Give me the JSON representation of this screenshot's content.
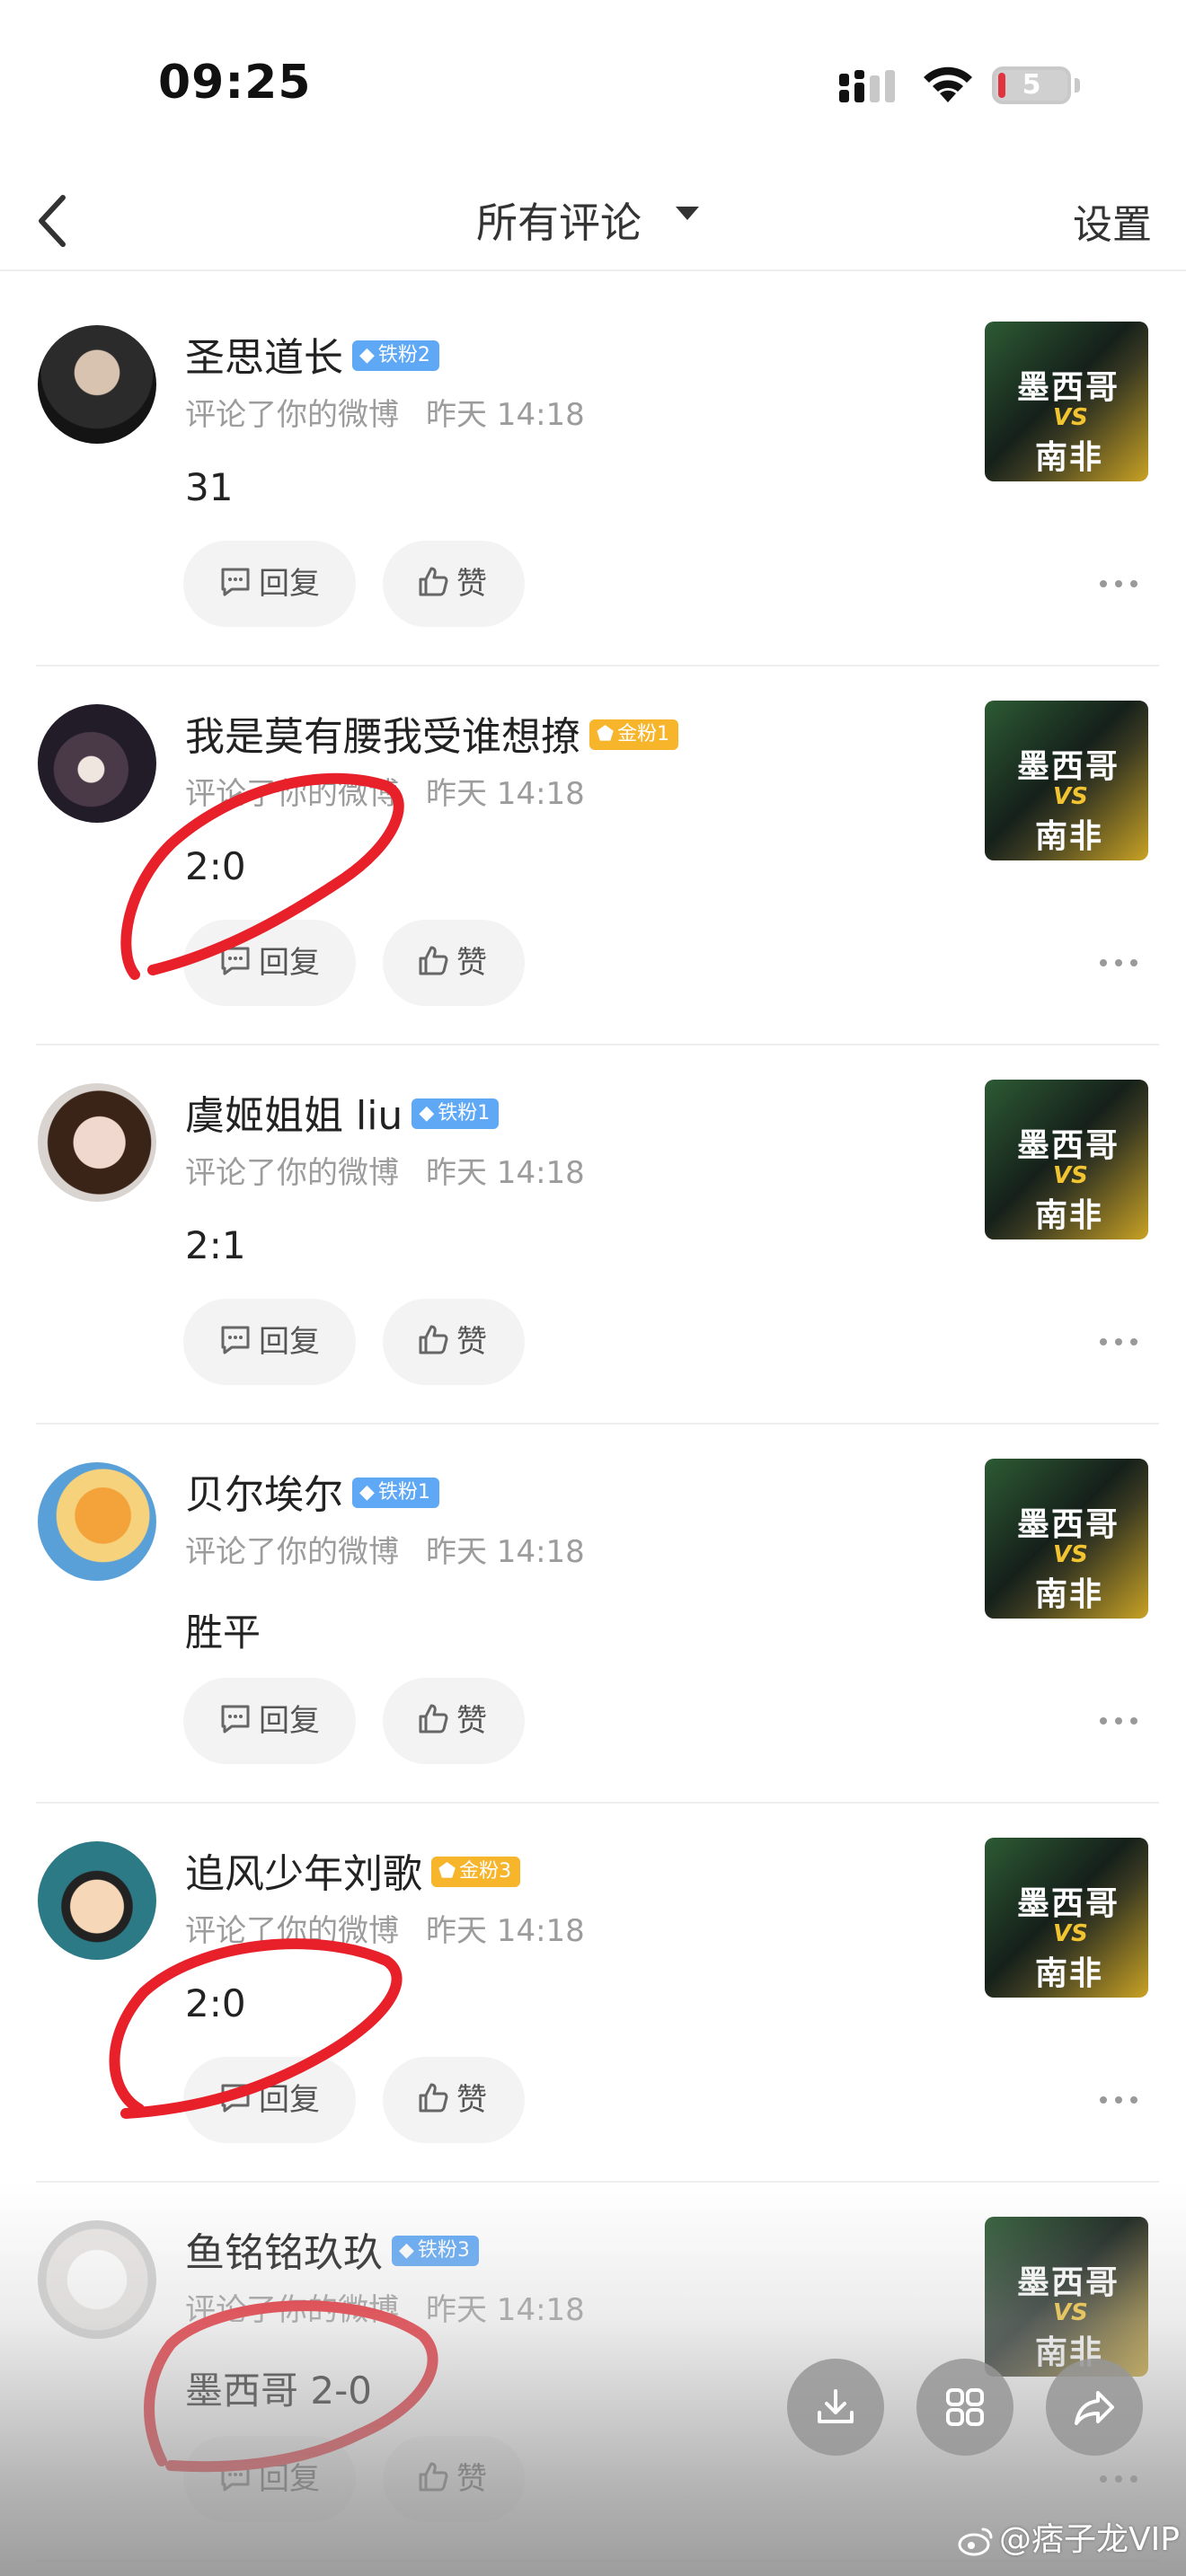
{
  "status": {
    "time": "09:25",
    "battery": "5"
  },
  "nav": {
    "title": "所有评论",
    "settings": "设置"
  },
  "actions": {
    "reply": "回复",
    "like": "赞"
  },
  "comments": [
    {
      "name": "圣思道长",
      "badge": "铁粉2",
      "badge_type": "iron",
      "action": "评论了你的微博",
      "time": "昨天 14:18",
      "text": "31"
    },
    {
      "name": "我是莫有腰我受谁想撩",
      "badge": "金粉1",
      "badge_type": "gold",
      "action": "评论了你的微博",
      "time": "昨天 14:18",
      "text": "2:0"
    },
    {
      "name": "虞姬姐姐 liu",
      "badge": "铁粉1",
      "badge_type": "iron",
      "action": "评论了你的微博",
      "time": "昨天 14:18",
      "text": "2:1"
    },
    {
      "name": "贝尔埃尔",
      "badge": "铁粉1",
      "badge_type": "iron",
      "action": "评论了你的微博",
      "time": "昨天 14:18",
      "text": "胜平"
    },
    {
      "name": "追风少年刘歌",
      "badge": "金粉3",
      "badge_type": "gold",
      "action": "评论了你的微博",
      "time": "昨天 14:18",
      "text": "2:0"
    },
    {
      "name": "鱼铭铭玖玖",
      "badge": "铁粉3",
      "badge_type": "iron",
      "action": "评论了你的微博",
      "time": "昨天 14:18",
      "text": "墨西哥 2-0"
    }
  ],
  "thumbnail": {
    "team1": "墨西哥",
    "vs": "VS",
    "team2": "南非"
  },
  "watermark": "@痞子龙VIP",
  "colors": {
    "iron_badge": "#5fa8f6",
    "gold_badge": "#f7b52c",
    "annotation": "#e8202a"
  }
}
